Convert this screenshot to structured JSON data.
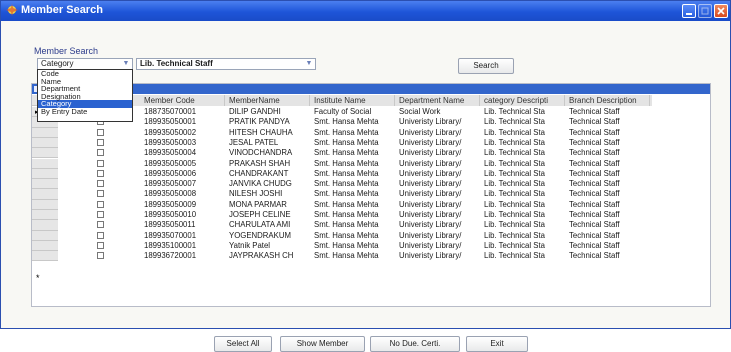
{
  "window": {
    "title": "Member Search"
  },
  "search": {
    "label": "Member Search",
    "category_value": "Category",
    "department_value": "Lib. Technical  Staff",
    "search_button": "Search"
  },
  "dropdown": {
    "options": [
      "Code",
      "Name",
      "Department",
      "Designation",
      "Category",
      "By Entry Date"
    ],
    "selected": "Category"
  },
  "grid": {
    "columns": [
      "Member Code",
      "MemberName",
      "Institute Name",
      "Department Name",
      "category Descripti",
      "Branch Description"
    ],
    "rows": [
      [
        "188735070001",
        "DILIP GANDHI",
        "Faculty of Social",
        "Social Work",
        "Lib. Technical Sta",
        "Technical Staff"
      ],
      [
        "189935050001",
        "PRATIK PANDYA",
        "Smt. Hansa Mehta",
        "Univeristy Library/",
        "Lib. Technical Sta",
        "Technical Staff"
      ],
      [
        "189935050002",
        "HITESH CHAUHA",
        "Smt. Hansa Mehta",
        "Univeristy Library/",
        "Lib. Technical Sta",
        "Technical Staff"
      ],
      [
        "189935050003",
        "JESAL PATEL",
        "Smt. Hansa Mehta",
        "Univeristy Library/",
        "Lib. Technical Sta",
        "Technical Staff"
      ],
      [
        "189935050004",
        "VINODCHANDRA",
        "Smt. Hansa Mehta",
        "Univeristy Library/",
        "Lib. Technical Sta",
        "Technical Staff"
      ],
      [
        "189935050005",
        "PRAKASH SHAH",
        "Smt. Hansa Mehta",
        "Univeristy Library/",
        "Lib. Technical Sta",
        "Technical Staff"
      ],
      [
        "189935050006",
        "CHANDRAKANT",
        "Smt. Hansa Mehta",
        "Univeristy Library/",
        "Lib. Technical Sta",
        "Technical Staff"
      ],
      [
        "189935050007",
        "JANVIKA CHUDG",
        "Smt. Hansa Mehta",
        "Univeristy Library/",
        "Lib. Technical Sta",
        "Technical Staff"
      ],
      [
        "189935050008",
        "NILESH JOSHI",
        "Smt. Hansa Mehta",
        "Univeristy Library/",
        "Lib. Technical Sta",
        "Technical Staff"
      ],
      [
        "189935050009",
        "MONA PARMAR",
        "Smt. Hansa Mehta",
        "Univeristy Library/",
        "Lib. Technical Sta",
        "Technical Staff"
      ],
      [
        "189935050010",
        "JOSEPH CELINE",
        "Smt. Hansa Mehta",
        "Univeristy Library/",
        "Lib. Technical Sta",
        "Technical Staff"
      ],
      [
        "189935050011",
        "CHARULATA AMI",
        "Smt. Hansa Mehta",
        "Univeristy Library/",
        "Lib. Technical Sta",
        "Technical Staff"
      ],
      [
        "189935070001",
        "YOGENDRAKUM",
        "Smt. Hansa Mehta",
        "Univeristy Library/",
        "Lib. Technical Sta",
        "Technical Staff"
      ],
      [
        "189935100001",
        "Yatnik Patel",
        "Smt. Hansa Mehta",
        "Univeristy Library/",
        "Lib. Technical Sta",
        "Technical Staff"
      ],
      [
        "189936720001",
        "JAYPRAKASH CH",
        "Smt. Hansa Mehta",
        "Univeristy Library/",
        "Lib. Technical Sta",
        "Technical Staff"
      ]
    ],
    "new_row_marker": "*",
    "current_row_marker": "▸"
  },
  "buttons": {
    "select_all": "Select All",
    "show_member": "Show Member",
    "no_due": "No Due. Certi.",
    "exit": "Exit"
  },
  "colors": {
    "titlebar": "#1e55d8",
    "selection": "#2a62d0",
    "grid_topbar": "#3366cc"
  }
}
